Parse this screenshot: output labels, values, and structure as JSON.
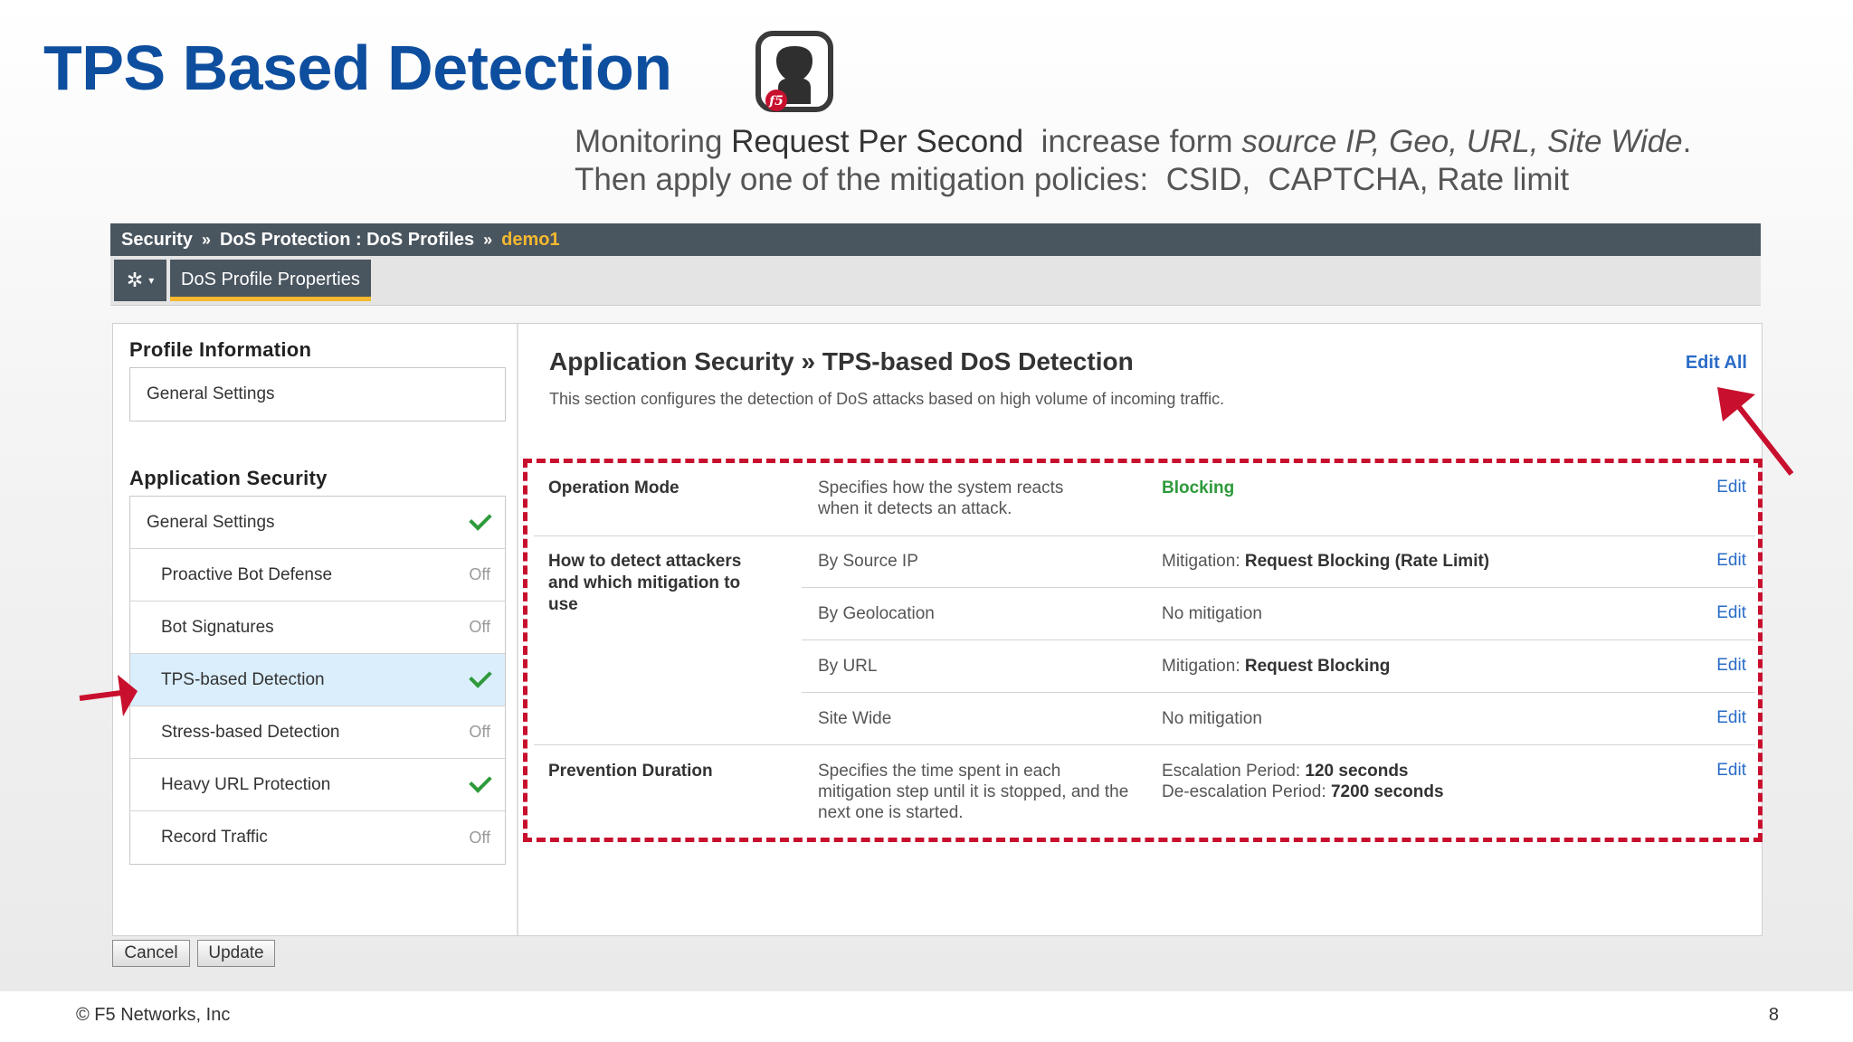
{
  "slide": {
    "title": "TPS Based Detection",
    "subtitle_line1_pre": "Monitoring ",
    "subtitle_line1_bold": "Request Per Second",
    "subtitle_line1_mid": "  increase form ",
    "subtitle_line1_italic": "source IP, Geo, URL, Site Wide",
    "subtitle_line1_end": ".",
    "subtitle_line2": "Then apply one of the mitigation policies:  CSID,  CAPTCHA, Rate limit",
    "logo_text": "f5",
    "copyright": "© F5 Networks, Inc",
    "page_number": "8"
  },
  "breadcrumb": {
    "items": [
      "Security",
      "DoS Protection : DoS Profiles",
      "demo1"
    ],
    "separator": "»"
  },
  "toolbar": {
    "gear_glyph": "✲",
    "caret_glyph": "▾",
    "active_tab": "DoS Profile Properties"
  },
  "sidebar": {
    "profile_heading": "Profile Information",
    "profile_items": [
      {
        "label": "General Settings"
      }
    ],
    "appsec_heading": "Application Security",
    "appsec_items": [
      {
        "label": "General Settings",
        "status": "check"
      },
      {
        "label": "Proactive Bot Defense",
        "status": "Off"
      },
      {
        "label": "Bot Signatures",
        "status": "Off"
      },
      {
        "label": "TPS-based Detection",
        "status": "check"
      },
      {
        "label": "Stress-based Detection",
        "status": "Off"
      },
      {
        "label": "Heavy URL Protection",
        "status": "check"
      },
      {
        "label": "Record Traffic",
        "status": "Off"
      }
    ]
  },
  "main": {
    "title": "Application Security » TPS-based DoS Detection",
    "description": "This section configures the detection of DoS attacks based on high volume of incoming traffic.",
    "edit_all": "Edit All",
    "operation_mode": {
      "label": "Operation Mode",
      "description": "Specifies how the system reacts when it detects an attack.",
      "value": "Blocking",
      "edit": "Edit"
    },
    "detect": {
      "label": "How to detect attackers and which mitigation to use",
      "rows": [
        {
          "criterion": "By Source IP",
          "prefix": "Mitigation: ",
          "value": "Request Blocking (Rate Limit)",
          "edit": "Edit"
        },
        {
          "criterion": "By Geolocation",
          "prefix": "No mitigation",
          "value": "",
          "edit": "Edit"
        },
        {
          "criterion": "By URL",
          "prefix": "Mitigation: ",
          "value": "Request Blocking",
          "edit": "Edit"
        },
        {
          "criterion": "Site Wide",
          "prefix": "No mitigation",
          "value": "",
          "edit": "Edit"
        }
      ]
    },
    "prevention": {
      "label": "Prevention Duration",
      "description": "Specifies the time spent in each mitigation step until it is stopped, and the next one is started.",
      "escalation_label": "Escalation Period: ",
      "escalation_value": "120 seconds",
      "deescalation_label": "De-escalation Period: ",
      "deescalation_value": "7200 seconds",
      "edit": "Edit"
    }
  },
  "buttons": {
    "cancel": "Cancel",
    "update": "Update"
  },
  "colors": {
    "title": "#0e4e9e",
    "highlight": "#c8102e",
    "blocking": "#2e9a3a",
    "link": "#2a6cc7",
    "crumb_active": "#f5b82e"
  }
}
